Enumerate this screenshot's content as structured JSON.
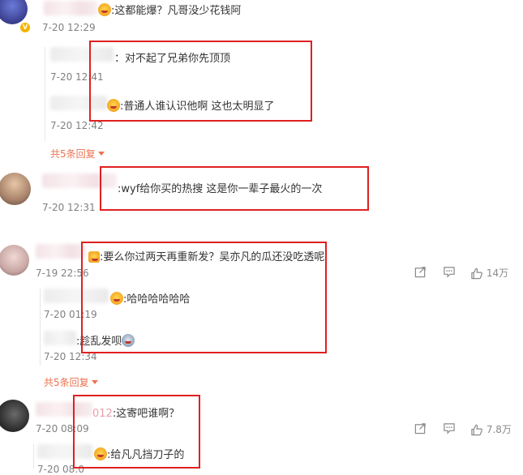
{
  "comments": [
    {
      "text": ":这都能爆？凡哥没少花钱阿",
      "time": "7-20 12:29",
      "replies": [
        {
          "text": "：对不起了兄弟你先顶顶",
          "time": "7-20 12:41"
        },
        {
          "text": ":普通人谁认识他啊 这也太明显了",
          "time": "7-20 12:42"
        }
      ],
      "more_replies": "共5条回复"
    },
    {
      "text": ":wyf给你买的热搜 这是你一辈子最火的一次",
      "time": "7-20 12:31"
    },
    {
      "text": ":要么你过两天再重新发？吴亦凡的瓜还没吃透呢",
      "time": "7-19 22:56",
      "likes": "14万",
      "replies": [
        {
          "text": ":哈哈哈哈哈哈",
          "time": "7-20 01:19"
        },
        {
          "text": ":趁乱发呗",
          "time": "7-20 12:34"
        }
      ],
      "more_replies": "共5条回复"
    },
    {
      "name_suffix": "012",
      "text": ":这寄吧谁啊？",
      "time": "7-20 08:09",
      "likes": "7.8万",
      "replies": [
        {
          "text": ":给凡凡挡刀子的",
          "time": "7-20 08:0"
        }
      ]
    }
  ],
  "icons": [
    "share-icon",
    "comment-icon",
    "like-icon",
    "emoji-icon",
    "verified-badge-icon"
  ],
  "colors": {
    "link": "#eb7350",
    "highlight_box": "#e02020",
    "meta": "#808080"
  }
}
